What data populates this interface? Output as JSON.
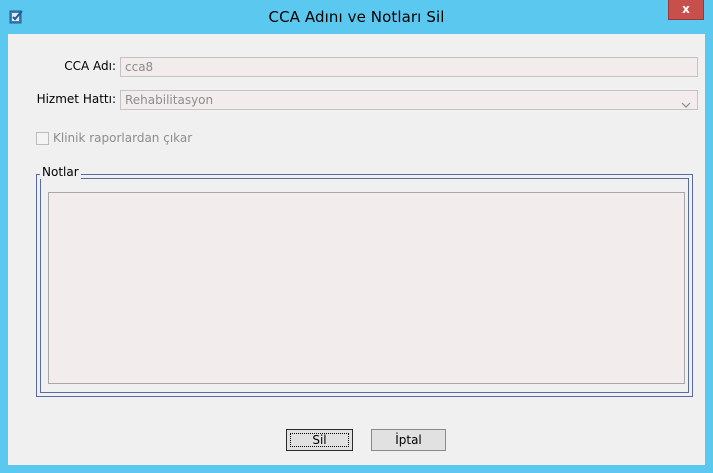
{
  "window": {
    "title": "CCA Adını ve Notları Sil",
    "close_label": "x"
  },
  "form": {
    "cca_name_label": "CCA Adı:",
    "cca_name_value": "cca8",
    "service_line_label": "Hizmet Hattı:",
    "service_line_value": "Rehabilitasyon",
    "exclude_label": "Klinik raporlardan çıkar",
    "exclude_checked": false,
    "notes_label": "Notlar",
    "notes_value": ""
  },
  "buttons": {
    "delete_label": "Sil",
    "cancel_label": "İptal"
  },
  "colors": {
    "titlebar": "#5bc8ef",
    "close_button": "#c7504c",
    "client_background": "#f0f0f0",
    "field_background": "#f2ecec",
    "group_border": "#5a6aa4"
  }
}
